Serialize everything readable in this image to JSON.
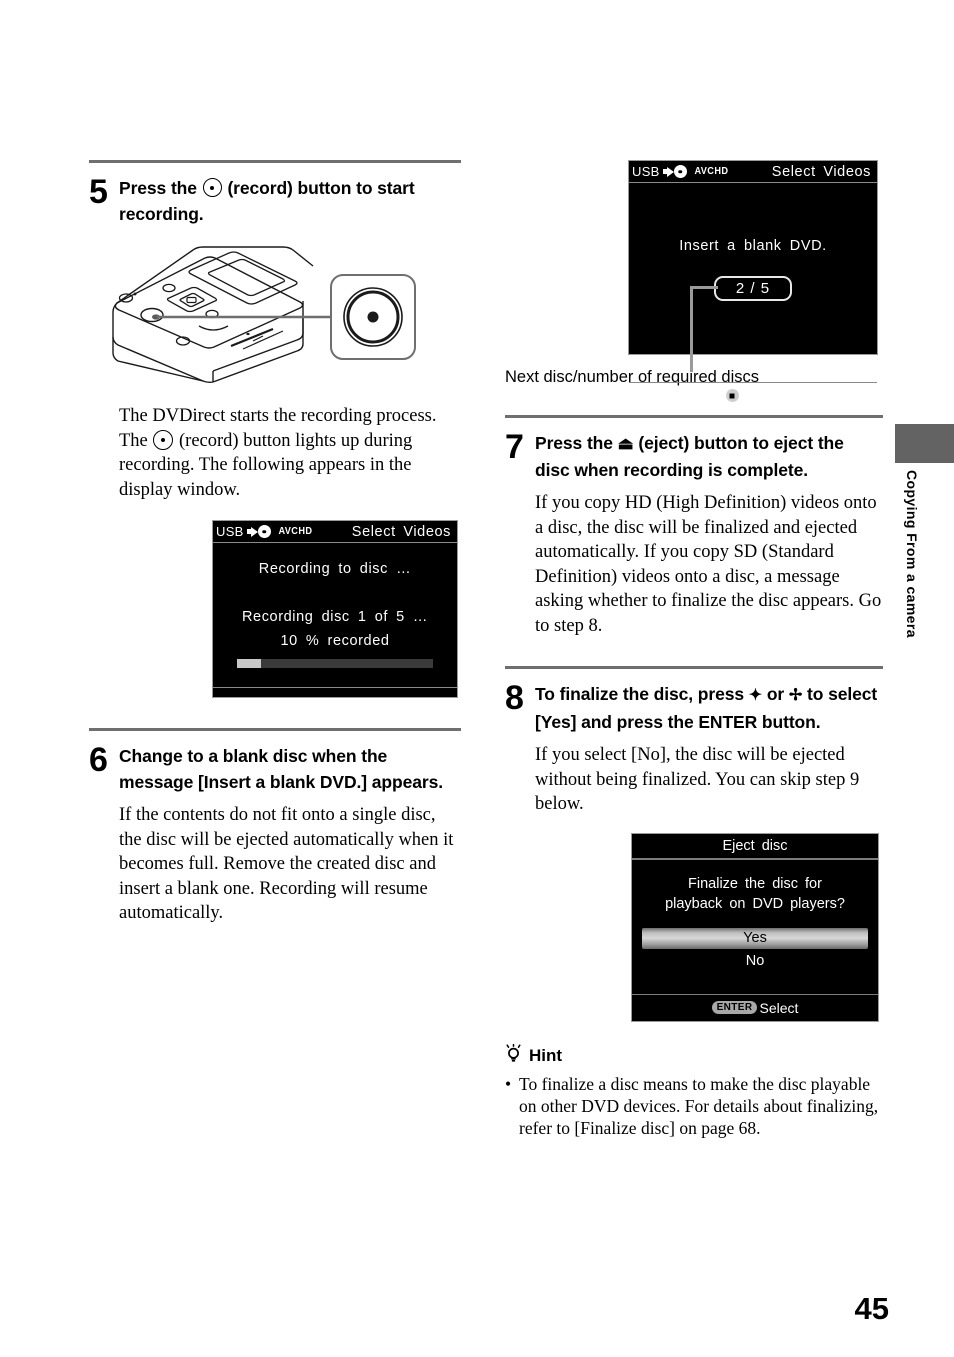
{
  "page": {
    "number": "45",
    "side_tab_label": "Copying From a camera"
  },
  "left_column": {
    "step5": {
      "number": "5",
      "heading_part1": "Press the",
      "heading_icon": "record-button-icon",
      "heading_part2": "(record) button to start recording.",
      "illustration_name": "dvdirect-device-illustration",
      "body_part1": "The DVDirect starts the recording process. The",
      "body_icon": "record-button-icon",
      "body_part2": "(record) button lights up during recording. The following appears in the display window.",
      "display": {
        "usb_label": "USB",
        "format_label": "AVCHD",
        "title": "Select Videos",
        "line1": "Recording to disc …",
        "line2": "Recording disc 1 of 5 …",
        "line3": "10 % recorded",
        "progress_percent": 10
      }
    },
    "step6": {
      "number": "6",
      "heading": "Change to a blank disc when the message [Insert a blank DVD.] appears.",
      "body": "If the contents do not fit onto a single disc, the disc will be ejected automatically when it becomes full. Remove the created disc and insert a blank one. Recording will resume automatically."
    }
  },
  "right_column": {
    "top_display": {
      "usb_label": "USB",
      "format_label": "AVCHD",
      "title": "Select Videos",
      "message": "Insert a blank DVD.",
      "counter": "2 / 5",
      "footer_icon": "stop-icon",
      "footer_label": "STOP",
      "caption": "Next disc/number of required discs"
    },
    "step7": {
      "number": "7",
      "heading_part1": "Press the",
      "heading_icon": "eject-icon",
      "heading_icon_glyph": "⏏",
      "heading_part2": "(eject) button to eject the disc when recording is complete.",
      "body": "If you copy HD (High Definition) videos onto a disc, the disc will be finalized and ejected automatically. If you copy SD (Standard Definition) videos onto a disc, a message asking whether to finalize the disc appears. Go to step 8."
    },
    "step8": {
      "number": "8",
      "heading_part1": "To finalize the disc, press",
      "heading_icon_up": "arrow-up-icon",
      "heading_icon_up_glyph": "✦",
      "heading_or": "or",
      "heading_icon_down": "arrow-down-icon",
      "heading_part2": "to select [Yes] and press the ENTER button.",
      "body": "If you select [No], the disc will be ejected without being finalized. You can skip step 9 below.",
      "dialog": {
        "title": "Eject disc",
        "question_line1": "Finalize the disc for",
        "question_line2": "playback on DVD players?",
        "option_yes": "Yes",
        "option_no": "No",
        "selected_option": "Yes",
        "footer_badge": "ENTER",
        "footer_label": "Select"
      }
    },
    "hint": {
      "icon": "lightbulb-icon",
      "title": "Hint",
      "bullet_glyph": "•",
      "text": "To finalize a disc means to make the disc playable on other DVD devices. For details about finalizing, refer to [Finalize disc] on page 68."
    }
  },
  "colors": {
    "rule": "#6f6f6f",
    "side_tab": "#636363",
    "lcd_bg": "#000000",
    "lcd_text": "#ffffff",
    "progress_fill": "#c8c8c8"
  }
}
